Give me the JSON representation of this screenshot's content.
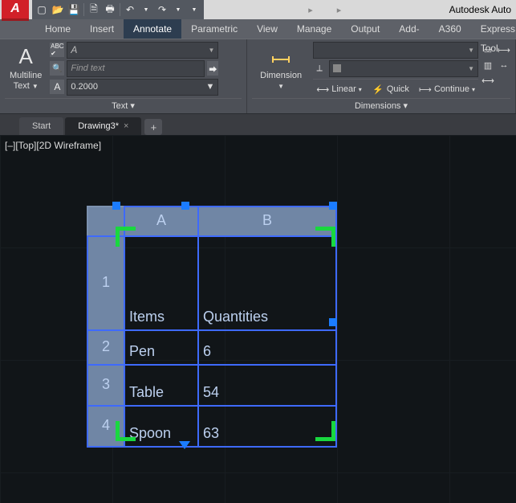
{
  "app": {
    "title": "Autodesk Auto",
    "logo_letter": "A"
  },
  "menus": {
    "items": [
      "Home",
      "Insert",
      "Annotate",
      "Parametric",
      "View",
      "Manage",
      "Output",
      "Add-ins",
      "A360",
      "Express Tool"
    ],
    "active": "Annotate"
  },
  "ribbon": {
    "text_panel": {
      "title": "Text ▾",
      "multiline_text": "Multiline\nText",
      "find_placeholder": "Find text",
      "height_value": "0.2000"
    },
    "dim_panel": {
      "title": "Dimensions ▾",
      "dimension": "Dimension",
      "linear": "Linear",
      "quick": "Quick",
      "continue": "Continue"
    }
  },
  "tabs": {
    "start": "Start",
    "drawing": "Drawing3*"
  },
  "viewport_label": "[–][Top][2D Wireframe]",
  "acad_table": {
    "columns": [
      "A",
      "B"
    ],
    "rows": [
      "1",
      "2",
      "3",
      "4"
    ],
    "cells": [
      [
        "Items",
        "Quantities"
      ],
      [
        "Pen",
        "6"
      ],
      [
        "Table",
        "54"
      ],
      [
        "Spoon",
        "63"
      ]
    ]
  },
  "chart_data": {
    "type": "table",
    "columns": [
      "Items",
      "Quantities"
    ],
    "rows": [
      {
        "Items": "Pen",
        "Quantities": 6
      },
      {
        "Items": "Table",
        "Quantities": 54
      },
      {
        "Items": "Spoon",
        "Quantities": 63
      }
    ]
  }
}
